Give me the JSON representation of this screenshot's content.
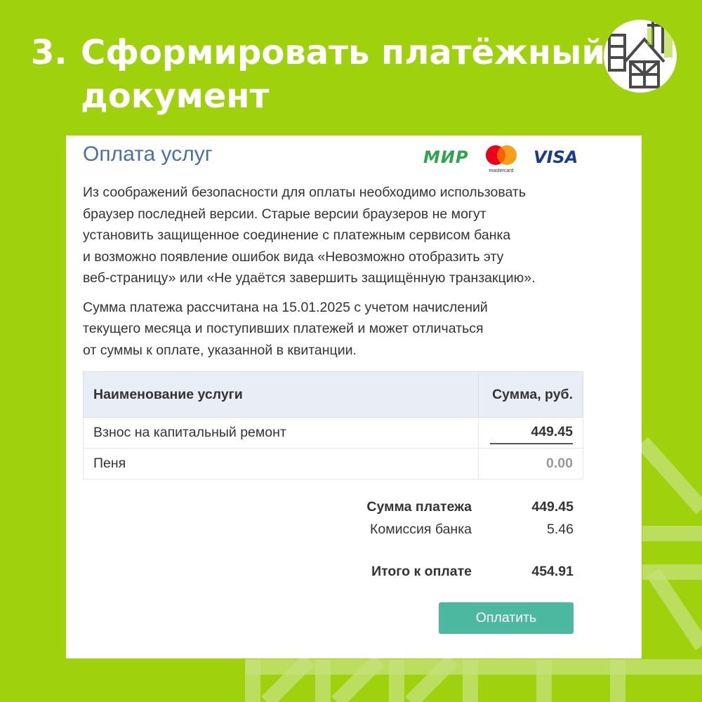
{
  "slide": {
    "number": "3.",
    "title": "Сформировать платёжный документ"
  },
  "colors": {
    "background": "#9fd10c",
    "title_text": "#ffffff",
    "card_title": "#4a6fa5",
    "pay_button": "#4db8a0"
  },
  "logo": {
    "icon": "house-logo-icon"
  },
  "payment_card": {
    "title": "Оплата услуг",
    "payment_systems": {
      "mir": "МИР",
      "mastercard": "mastercard",
      "visa": "VISA"
    },
    "notice_security": "Из соображений безопасности для оплаты необходимо использовать\nбраузер последней версии. Старые версии браузеров не могут\nустановить защищенное соединение с платежным сервисом банка\nи возможно появление ошибок вида «Невозможно отобразить эту\nвеб-страницу» или «Не удаётся завершить защищённую транзакцию».",
    "notice_amount": "Сумма платежа рассчитана на 15.01.2025 с учетом начислений\nтекущего месяца и поступивших платежей и может отличаться\nот суммы к оплате, указанной в квитанции.",
    "table": {
      "headers": {
        "service": "Наименование услуги",
        "amount": "Сумма, руб."
      },
      "rows": [
        {
          "service": "Взнос на капитальный ремонт",
          "amount": "449.45"
        },
        {
          "service": "Пеня",
          "amount": "0.00"
        }
      ]
    },
    "summary": {
      "payment_sum_label": "Сумма платежа",
      "payment_sum_value": "449.45",
      "bank_fee_label": "Комиссия банка",
      "bank_fee_value": "5.46",
      "total_label": "Итого к оплате",
      "total_value": "454.91"
    },
    "pay_button_label": "Оплатить"
  }
}
